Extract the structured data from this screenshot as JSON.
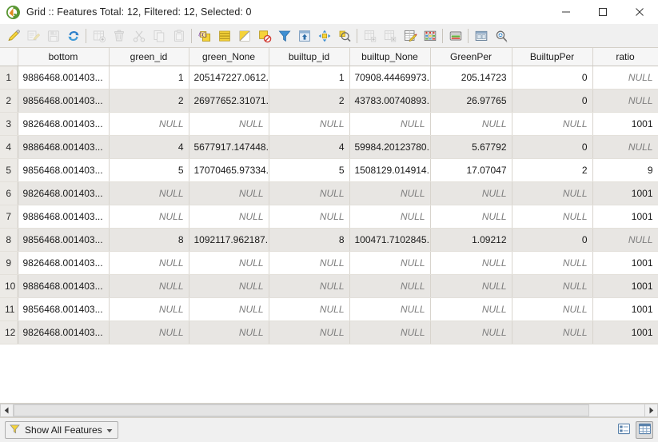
{
  "window": {
    "title": "Grid :: Features Total: 12, Filtered: 12, Selected: 0",
    "logo_icon": "qgis-logo-icon",
    "minimize_label": "—",
    "maximize_label": "□",
    "close_label": "✕"
  },
  "toolbar": {
    "buttons": [
      {
        "name": "toggle-editing-icon",
        "tooltip": "Toggle editing mode",
        "enabled": true
      },
      {
        "name": "multi-edit-icon",
        "tooltip": "Toggle multi edit mode",
        "enabled": false
      },
      {
        "name": "save-edits-icon",
        "tooltip": "Save edits",
        "enabled": false
      },
      {
        "name": "reload-table-icon",
        "tooltip": "Reload the table",
        "enabled": true
      },
      {
        "name": "new-field-icon",
        "tooltip": "New field",
        "enabled": false
      },
      {
        "name": "delete-field-icon",
        "tooltip": "Delete field",
        "enabled": false
      },
      {
        "name": "cut-features-icon",
        "tooltip": "Cut selected rows to clipboard",
        "enabled": false
      },
      {
        "name": "copy-features-icon",
        "tooltip": "Copy selected rows to clipboard",
        "enabled": false
      },
      {
        "name": "paste-features-icon",
        "tooltip": "Paste features from clipboard",
        "enabled": false
      },
      {
        "name": "select-by-expression-icon",
        "tooltip": "Select features using an expression",
        "enabled": true
      },
      {
        "name": "select-all-icon",
        "tooltip": "Select all",
        "enabled": true
      },
      {
        "name": "invert-selection-icon",
        "tooltip": "Invert selection",
        "enabled": true
      },
      {
        "name": "deselect-all-icon",
        "tooltip": "Deselect all",
        "enabled": true
      },
      {
        "name": "filter-expression-icon",
        "tooltip": "Filter features using an expression",
        "enabled": true
      },
      {
        "name": "move-selection-to-top-icon",
        "tooltip": "Move selection to top",
        "enabled": true
      },
      {
        "name": "pan-to-selection-icon",
        "tooltip": "Pan map to the selected rows",
        "enabled": true
      },
      {
        "name": "zoom-to-selection-icon",
        "tooltip": "Zoom map to the selected rows",
        "enabled": true
      },
      {
        "name": "add-feature-icon",
        "tooltip": "Add feature",
        "enabled": false
      },
      {
        "name": "delete-selected-icon",
        "tooltip": "Delete selected features",
        "enabled": false
      },
      {
        "name": "field-calculator-icon",
        "tooltip": "Open field calculator",
        "enabled": true
      },
      {
        "name": "conditional-formatting-icon",
        "tooltip": "Conditional formatting",
        "enabled": true
      },
      {
        "name": "organize-columns-icon",
        "tooltip": "Organize columns",
        "enabled": true
      },
      {
        "name": "dock-window-icon",
        "tooltip": "Dock attribute table",
        "enabled": true
      },
      {
        "name": "actions-icon",
        "tooltip": "Actions",
        "enabled": true
      }
    ]
  },
  "table": {
    "columns": [
      "bottom",
      "green_id",
      "green_None",
      "builtup_id",
      "builtup_None",
      "GreenPer",
      "BuiltupPer",
      "ratio"
    ],
    "null_text": "NULL",
    "rows": [
      {
        "n": "1",
        "cells": [
          "9886468.001403...",
          "1",
          "205147227.0612...",
          "1",
          "70908.44469973...",
          "205.14723",
          "0",
          "NULL"
        ]
      },
      {
        "n": "2",
        "cells": [
          "9856468.001403...",
          "2",
          "26977652.31071...",
          "2",
          "43783.00740893...",
          "26.97765",
          "0",
          "NULL"
        ]
      },
      {
        "n": "3",
        "cells": [
          "9826468.001403...",
          "NULL",
          "NULL",
          "NULL",
          "NULL",
          "NULL",
          "NULL",
          "1001"
        ]
      },
      {
        "n": "4",
        "cells": [
          "9886468.001403...",
          "4",
          "5677917.147448...",
          "4",
          "59984.20123780...",
          "5.67792",
          "0",
          "NULL"
        ]
      },
      {
        "n": "5",
        "cells": [
          "9856468.001403...",
          "5",
          "17070465.97334...",
          "5",
          "1508129.014914...",
          "17.07047",
          "2",
          "9"
        ]
      },
      {
        "n": "6",
        "cells": [
          "9826468.001403...",
          "NULL",
          "NULL",
          "NULL",
          "NULL",
          "NULL",
          "NULL",
          "1001"
        ]
      },
      {
        "n": "7",
        "cells": [
          "9886468.001403...",
          "NULL",
          "NULL",
          "NULL",
          "NULL",
          "NULL",
          "NULL",
          "1001"
        ]
      },
      {
        "n": "8",
        "cells": [
          "9856468.001403...",
          "8",
          "1092117.962187...",
          "8",
          "100471.7102845...",
          "1.09212",
          "0",
          "NULL"
        ]
      },
      {
        "n": "9",
        "cells": [
          "9826468.001403...",
          "NULL",
          "NULL",
          "NULL",
          "NULL",
          "NULL",
          "NULL",
          "1001"
        ]
      },
      {
        "n": "10",
        "cells": [
          "9886468.001403...",
          "NULL",
          "NULL",
          "NULL",
          "NULL",
          "NULL",
          "NULL",
          "1001"
        ]
      },
      {
        "n": "11",
        "cells": [
          "9856468.001403...",
          "NULL",
          "NULL",
          "NULL",
          "NULL",
          "NULL",
          "NULL",
          "1001"
        ]
      },
      {
        "n": "12",
        "cells": [
          "9826468.001403...",
          "NULL",
          "NULL",
          "NULL",
          "NULL",
          "NULL",
          "NULL",
          "1001"
        ]
      }
    ]
  },
  "statusbar": {
    "filter_button_label": "Show All Features",
    "filter_icon": "funnel-icon",
    "filter_dropdown_icon": "chevron-down-icon",
    "form_view_icon": "form-view-icon",
    "table_view_icon": "table-view-icon",
    "active_view": "table"
  },
  "colors": {
    "accent_yellow": "#f5d33a",
    "accent_blue": "#3f7fc4",
    "row_alt": "#e8e6e3",
    "null_text": "#7d7d7d",
    "window_bg": "#f0f0f0"
  }
}
